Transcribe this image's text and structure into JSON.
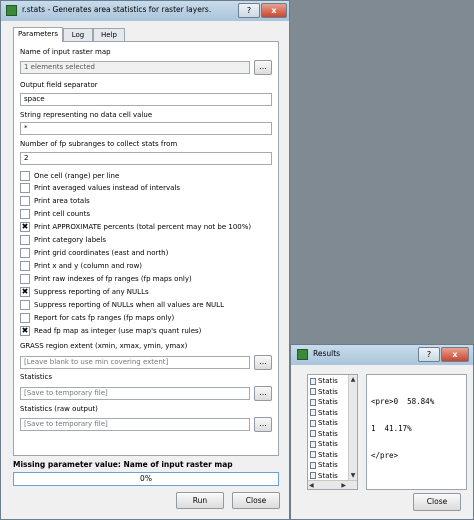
{
  "main_window": {
    "title": "r.stats - Generates area statistics for raster layers.",
    "tabs": [
      "Parameters",
      "Log",
      "Help"
    ],
    "fields": [
      {
        "label": "Name of input raster map",
        "value": "1 elements selected",
        "browse": "..."
      },
      {
        "label": "Output field separator",
        "value": "space"
      },
      {
        "label": "String representing no data cell value",
        "value": "*"
      },
      {
        "label": "Number of fp subranges to collect stats from",
        "value": "2"
      }
    ],
    "checkboxes": [
      {
        "label": "One cell (range) per line",
        "checked": false
      },
      {
        "label": "Print averaged values instead of intervals",
        "checked": false
      },
      {
        "label": "Print area totals",
        "checked": false
      },
      {
        "label": "Print cell counts",
        "checked": false
      },
      {
        "label": "Print APPROXIMATE percents (total percent may not be 100%)",
        "checked": true
      },
      {
        "label": "Print category labels",
        "checked": false
      },
      {
        "label": "Print grid coordinates (east and north)",
        "checked": false
      },
      {
        "label": "Print x and y (column and row)",
        "checked": false
      },
      {
        "label": "Print raw indexes of fp ranges (fp maps only)",
        "checked": false
      },
      {
        "label": "Suppress reporting of any NULLs",
        "checked": true
      },
      {
        "label": "Suppress reporting of NULLs when all values are NULL",
        "checked": false
      },
      {
        "label": "Report for cats fp ranges (fp maps only)",
        "checked": false
      },
      {
        "label": "Read fp map as integer (use map's quant rules)",
        "checked": true
      }
    ],
    "region": {
      "label": "GRASS region extent (xmin, xmax, ymin, ymax)",
      "placeholder": "[Leave blank to use min covering extent]",
      "browse": "..."
    },
    "outputs": [
      {
        "label": "Statistics",
        "placeholder": "[Save to temporary file]",
        "browse": "..."
      },
      {
        "label": "Statistics (raw output)",
        "placeholder": "[Save to temporary file]",
        "browse": "..."
      }
    ],
    "status": "Missing parameter value: Name of input raster map",
    "progress": {
      "fraction": 0.0,
      "text": "0%"
    },
    "run_label": "Run",
    "close_label": "Close",
    "title_buttons": {
      "help": "?",
      "close": "x"
    }
  },
  "results_window": {
    "title": "Results",
    "title_buttons": {
      "help": "?",
      "close": "x"
    },
    "list_items": [
      "Statis",
      "Statis",
      "Statis",
      "Statis",
      "Statis",
      "Statis",
      "Statis",
      "Statis",
      "Statis",
      "Statis"
    ],
    "content_lines": [
      "<pre>0  58.84%",
      "1  41.17%",
      "</pre>"
    ],
    "close_label": "Close"
  },
  "colors": {
    "titlebar": "#b7cde0",
    "progress_border": "#6aa0d8",
    "close_button": "#c8462c",
    "desktop": "#7f8a93"
  }
}
